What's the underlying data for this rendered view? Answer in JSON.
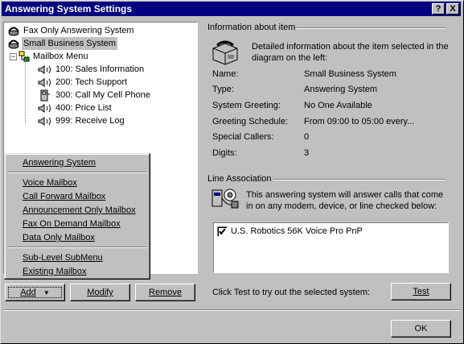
{
  "window": {
    "title": "Answering System Settings",
    "help_glyph": "?",
    "close_glyph": "X"
  },
  "tree": {
    "items": [
      {
        "label": "Fax Only Answering System"
      },
      {
        "label": "Small Business System"
      },
      {
        "label": "Mailbox Menu"
      },
      {
        "label": "100: Sales Information"
      },
      {
        "label": "200: Tech Support"
      },
      {
        "label": "300: Call My Cell Phone"
      },
      {
        "label": "400: Price List"
      },
      {
        "label": "999: Receive Log"
      }
    ]
  },
  "context_menu": {
    "items": [
      "Answering System",
      "Voice Mailbox",
      "Call Forward Mailbox",
      "Announcement Only Mailbox",
      "Fax On Demand Mailbox",
      "Data Only Mailbox",
      "Sub-Level SubMenu",
      "Existing Mailbox"
    ]
  },
  "buttons": {
    "add": "Add",
    "modify": "Modify",
    "remove": "Remove",
    "test": "Test",
    "ok": "OK"
  },
  "info": {
    "header": "Information about item",
    "description": "Detailed information about the item selected in the diagram on the left:",
    "rows": [
      {
        "label": "Name:",
        "value": "Small Business System"
      },
      {
        "label": "Type:",
        "value": "Answering System"
      },
      {
        "label": "System Greeting:",
        "value": "No One Available"
      },
      {
        "label": "Greeting Schedule:",
        "value": "From 09:00  to 05:00  every..."
      },
      {
        "label": "Special Callers:",
        "value": "0"
      },
      {
        "label": "Digits:",
        "value": "3"
      }
    ]
  },
  "line_association": {
    "header": "Line Association",
    "description": "This answering system will answer calls that come in on any modem, device, or line checked below:",
    "devices": [
      {
        "label": "U.S. Robotics 56K Voice Pro PnP",
        "checked": true
      }
    ]
  },
  "test_hint": "Click Test to try out the selected system:"
}
